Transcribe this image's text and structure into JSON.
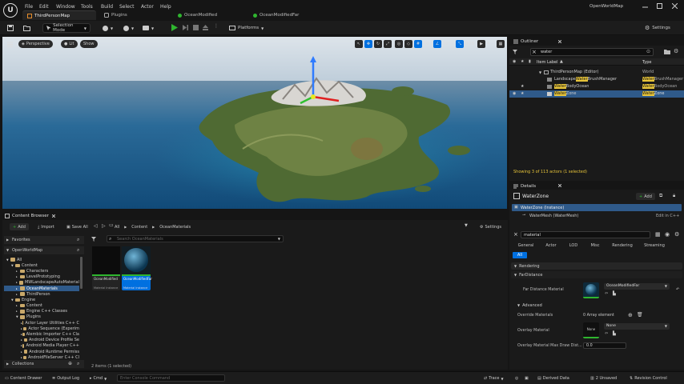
{
  "title_bar": {
    "logo_text": "U",
    "menus": [
      "File",
      "Edit",
      "Window",
      "Tools",
      "Build",
      "Select",
      "Actor",
      "Help"
    ],
    "tabs": [
      {
        "label": "ThirdPersonMap",
        "icon": "level-icon"
      },
      {
        "label": "Plugins",
        "icon": "plugin-icon"
      },
      {
        "label": "OceanModified",
        "icon": "material-icon"
      },
      {
        "label": "OceanModifiedFar",
        "icon": "material-icon"
      }
    ],
    "project_name": "OpenWorldMap",
    "window_controls": [
      "minimize",
      "maximize",
      "close"
    ]
  },
  "toolbar": {
    "mode_label": "Selection Mode",
    "platforms_label": "Platforms",
    "settings_label": "Settings"
  },
  "viewport": {
    "perspective_label": "Perspective",
    "lit_label": "Lit",
    "show_label": "Show",
    "grid_snap": "10",
    "rotation_snap": "10°",
    "scale_snap": "0.25",
    "camera_speed": "4"
  },
  "outliner": {
    "tab_label": "Outliner",
    "search_value": "water",
    "column_item_label": "Item Label",
    "column_type": "Type",
    "rows": [
      {
        "label": "ThirdPersonMap (Editor)",
        "match": "",
        "rest": "",
        "type": "World",
        "type_match": "",
        "type_rest": ""
      },
      {
        "label": "Landscape",
        "match": "Water",
        "rest": "BrushManager",
        "type": "",
        "type_match": "Water",
        "type_rest": "BrushManager"
      },
      {
        "label": "",
        "match": "Water",
        "rest": "BodyOcean",
        "type": "",
        "type_match": "Water",
        "type_rest": "BodyOcean"
      },
      {
        "label": "",
        "match": "Water",
        "rest": "Zone",
        "type": "",
        "type_match": "Water",
        "type_rest": "Zone"
      }
    ],
    "footer": "Showing 3 of 113 actors (1 selected)"
  },
  "details": {
    "tab_label": "Details",
    "actor_name": "WaterZone",
    "add_label": "Add",
    "instance_label": "WaterZone (Instance)",
    "component_label": "WaterMesh (WaterMesh)",
    "edit_cpp_label": "Edit in C++",
    "search_value": "material",
    "filter_tabs": [
      "General",
      "Actor",
      "LOD",
      "Misc",
      "Rendering",
      "Streaming"
    ],
    "all_label": "All",
    "section_rendering": "Rendering",
    "section_far_distance": "FarDistance",
    "far_distance_material_label": "Far Distance Material",
    "far_distance_material_value": "OceanModifiedFar",
    "section_advanced": "Advanced",
    "override_materials_label": "Override Materials",
    "override_materials_value": "0 Array element",
    "overlay_material_label": "Overlay Material",
    "overlay_thumb_text": "None",
    "overlay_material_value": "None",
    "overlay_max_draw_label": "Overlay Material Max Draw Dist...",
    "overlay_max_draw_value": "0.0"
  },
  "content_browser": {
    "tab_label": "Content Browser",
    "add_label": "Add",
    "import_label": "Import",
    "save_all_label": "Save All",
    "path": [
      "All",
      "Content",
      "OceanMaterials"
    ],
    "settings_label": "Settings",
    "favorites_label": "Favorites",
    "project_label": "OpenWorldMap",
    "search_placeholder": "Search OceanMaterials",
    "collections_label": "Collections",
    "status": "2 items (1 selected)",
    "tree": [
      {
        "label": "All",
        "depth": 0,
        "kind": "root"
      },
      {
        "label": "Content",
        "depth": 1,
        "kind": "open"
      },
      {
        "label": "Characters",
        "depth": 2,
        "kind": "folder"
      },
      {
        "label": "LevelPrototyping",
        "depth": 2,
        "kind": "folder"
      },
      {
        "label": "MWLandscapeAutoMaterial",
        "depth": 2,
        "kind": "folder"
      },
      {
        "label": "OceanMaterials",
        "depth": 2,
        "kind": "selected"
      },
      {
        "label": "ThirdPerson",
        "depth": 2,
        "kind": "folder"
      },
      {
        "label": "Engine",
        "depth": 1,
        "kind": "open"
      },
      {
        "label": "Content",
        "depth": 2,
        "kind": "folder"
      },
      {
        "label": "Engine C++ Classes",
        "depth": 2,
        "kind": "folder"
      },
      {
        "label": "Plugins",
        "depth": 2,
        "kind": "open"
      },
      {
        "label": "Actor Layer Utilities C++ C",
        "depth": 3,
        "kind": "folder"
      },
      {
        "label": "Actor Sequence (Experim",
        "depth": 3,
        "kind": "folder"
      },
      {
        "label": "Alembic Importer C++ Cla",
        "depth": 3,
        "kind": "folder"
      },
      {
        "label": "Android Device Profile Se",
        "depth": 3,
        "kind": "folder"
      },
      {
        "label": "Android Media Player C++",
        "depth": 3,
        "kind": "folder"
      },
      {
        "label": "Android Runtime Permiss",
        "depth": 3,
        "kind": "folder"
      },
      {
        "label": "AndroidFileServer C++ Cl",
        "depth": 3,
        "kind": "folder"
      }
    ],
    "assets": [
      {
        "name": "OceanModified",
        "type": "Material Instance",
        "selected": false
      },
      {
        "name": "OceanModifiedFar",
        "type": "Material Instance",
        "selected": true
      }
    ]
  },
  "status_bar": {
    "content_drawer_label": "Content Drawer",
    "output_log_label": "Output Log",
    "cmd_label": "Cmd",
    "console_placeholder": "Enter Console Command",
    "trace_label": "Trace",
    "derived_data_label": "Derived Data",
    "unsaved_label": "2 Unsaved",
    "revision_control_label": "Revision Control"
  },
  "colors": {
    "accent_blue": "#0070e0",
    "highlight_yellow": "#e8c53a",
    "play_green": "#2fb52f",
    "selection_row": "#2f5a8a"
  }
}
